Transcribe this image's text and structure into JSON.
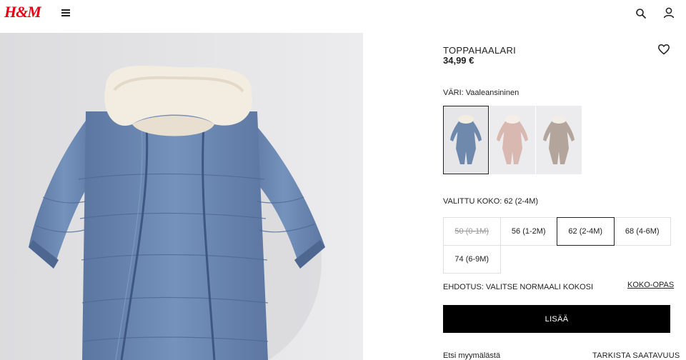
{
  "header": {
    "logo_text": "H&M",
    "menu_icon": "menu-icon",
    "search_icon": "search-icon",
    "account_icon": "account-icon"
  },
  "product": {
    "name": "TOPPAHAALARI",
    "price": "34,99 €",
    "color_label": "VÄRI: Vaaleansininen",
    "colors": [
      {
        "name": "Vaaleansininen",
        "hex": "#6f89ad",
        "selected": true
      },
      {
        "name": "Vaaleanpunainen",
        "hex": "#d9b8b2",
        "selected": false
      },
      {
        "name": "Beige",
        "hex": "#b3a59c",
        "selected": false
      }
    ],
    "selected_size_label": "VALITTU KOKO: 62 (2-4M)",
    "sizes": [
      {
        "label": "50 (0-1M)",
        "available": false,
        "selected": false
      },
      {
        "label": "56 (1-2M)",
        "available": true,
        "selected": false
      },
      {
        "label": "62 (2-4M)",
        "available": true,
        "selected": true
      },
      {
        "label": "68 (4-6M)",
        "available": true,
        "selected": false
      },
      {
        "label": "74 (6-9M)",
        "available": true,
        "selected": false
      }
    ],
    "suggestion": "EHDOTUS: VALITSE NORMAALI KOKOSI",
    "size_guide": "KOKO-OPAS",
    "add_button": "LISÄÄ",
    "store_label": "Etsi myymälästä",
    "availability_link": "TARKISTA SAATAVUUS",
    "favorite_icon": "heart-icon"
  },
  "colors": {
    "brand": "#e50010",
    "button_bg": "#000000",
    "image_bg": "#e6e6e8"
  }
}
